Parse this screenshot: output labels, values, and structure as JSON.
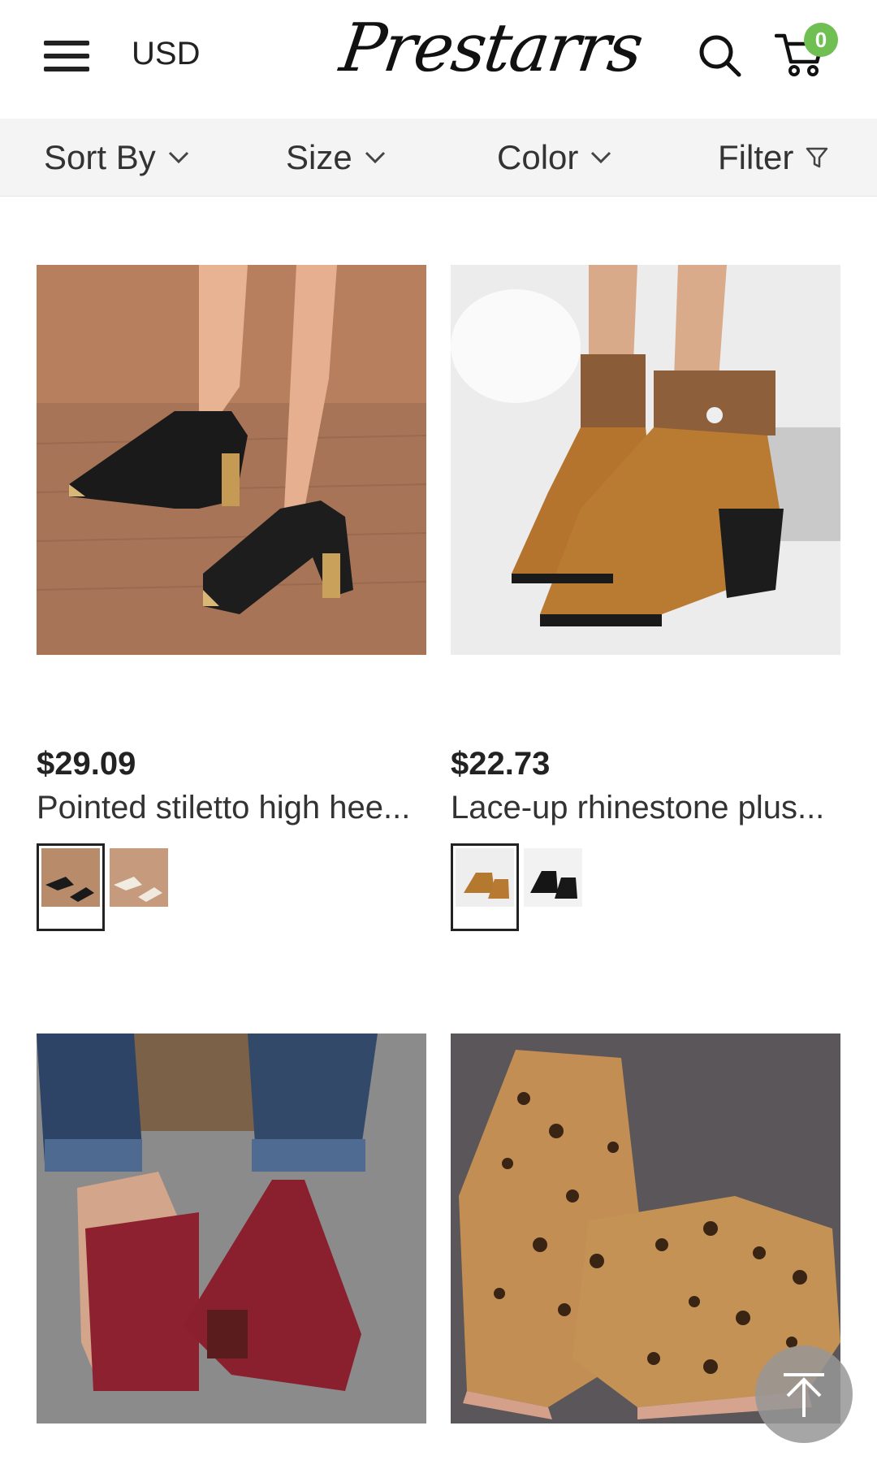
{
  "header": {
    "currency": "USD",
    "logo_text": "Prestarrs",
    "cart_count": "0",
    "icons": [
      "menu-icon",
      "search-icon",
      "cart-icon"
    ]
  },
  "filters": [
    {
      "label": "Sort By",
      "icon": "chevron-down-icon"
    },
    {
      "label": "Size",
      "icon": "chevron-down-icon"
    },
    {
      "label": "Color",
      "icon": "chevron-down-icon"
    },
    {
      "label": "Filter",
      "icon": "filter-icon"
    }
  ],
  "products": [
    {
      "price": "$29.09",
      "name": "Pointed stiletto high hee...",
      "swatch_count": 2,
      "selected_swatch": 0
    },
    {
      "price": "$22.73",
      "name": "Lace-up rhinestone plus...",
      "swatch_count": 2,
      "selected_swatch": 0
    },
    {
      "price": "",
      "name": ""
    },
    {
      "price": "",
      "name": ""
    }
  ],
  "colors": {
    "badge": "#6fbf52",
    "filter_bar_bg": "#f4f4f4",
    "back_to_top": "#969696"
  },
  "floating": {
    "icon": "arrow-up-icon"
  }
}
